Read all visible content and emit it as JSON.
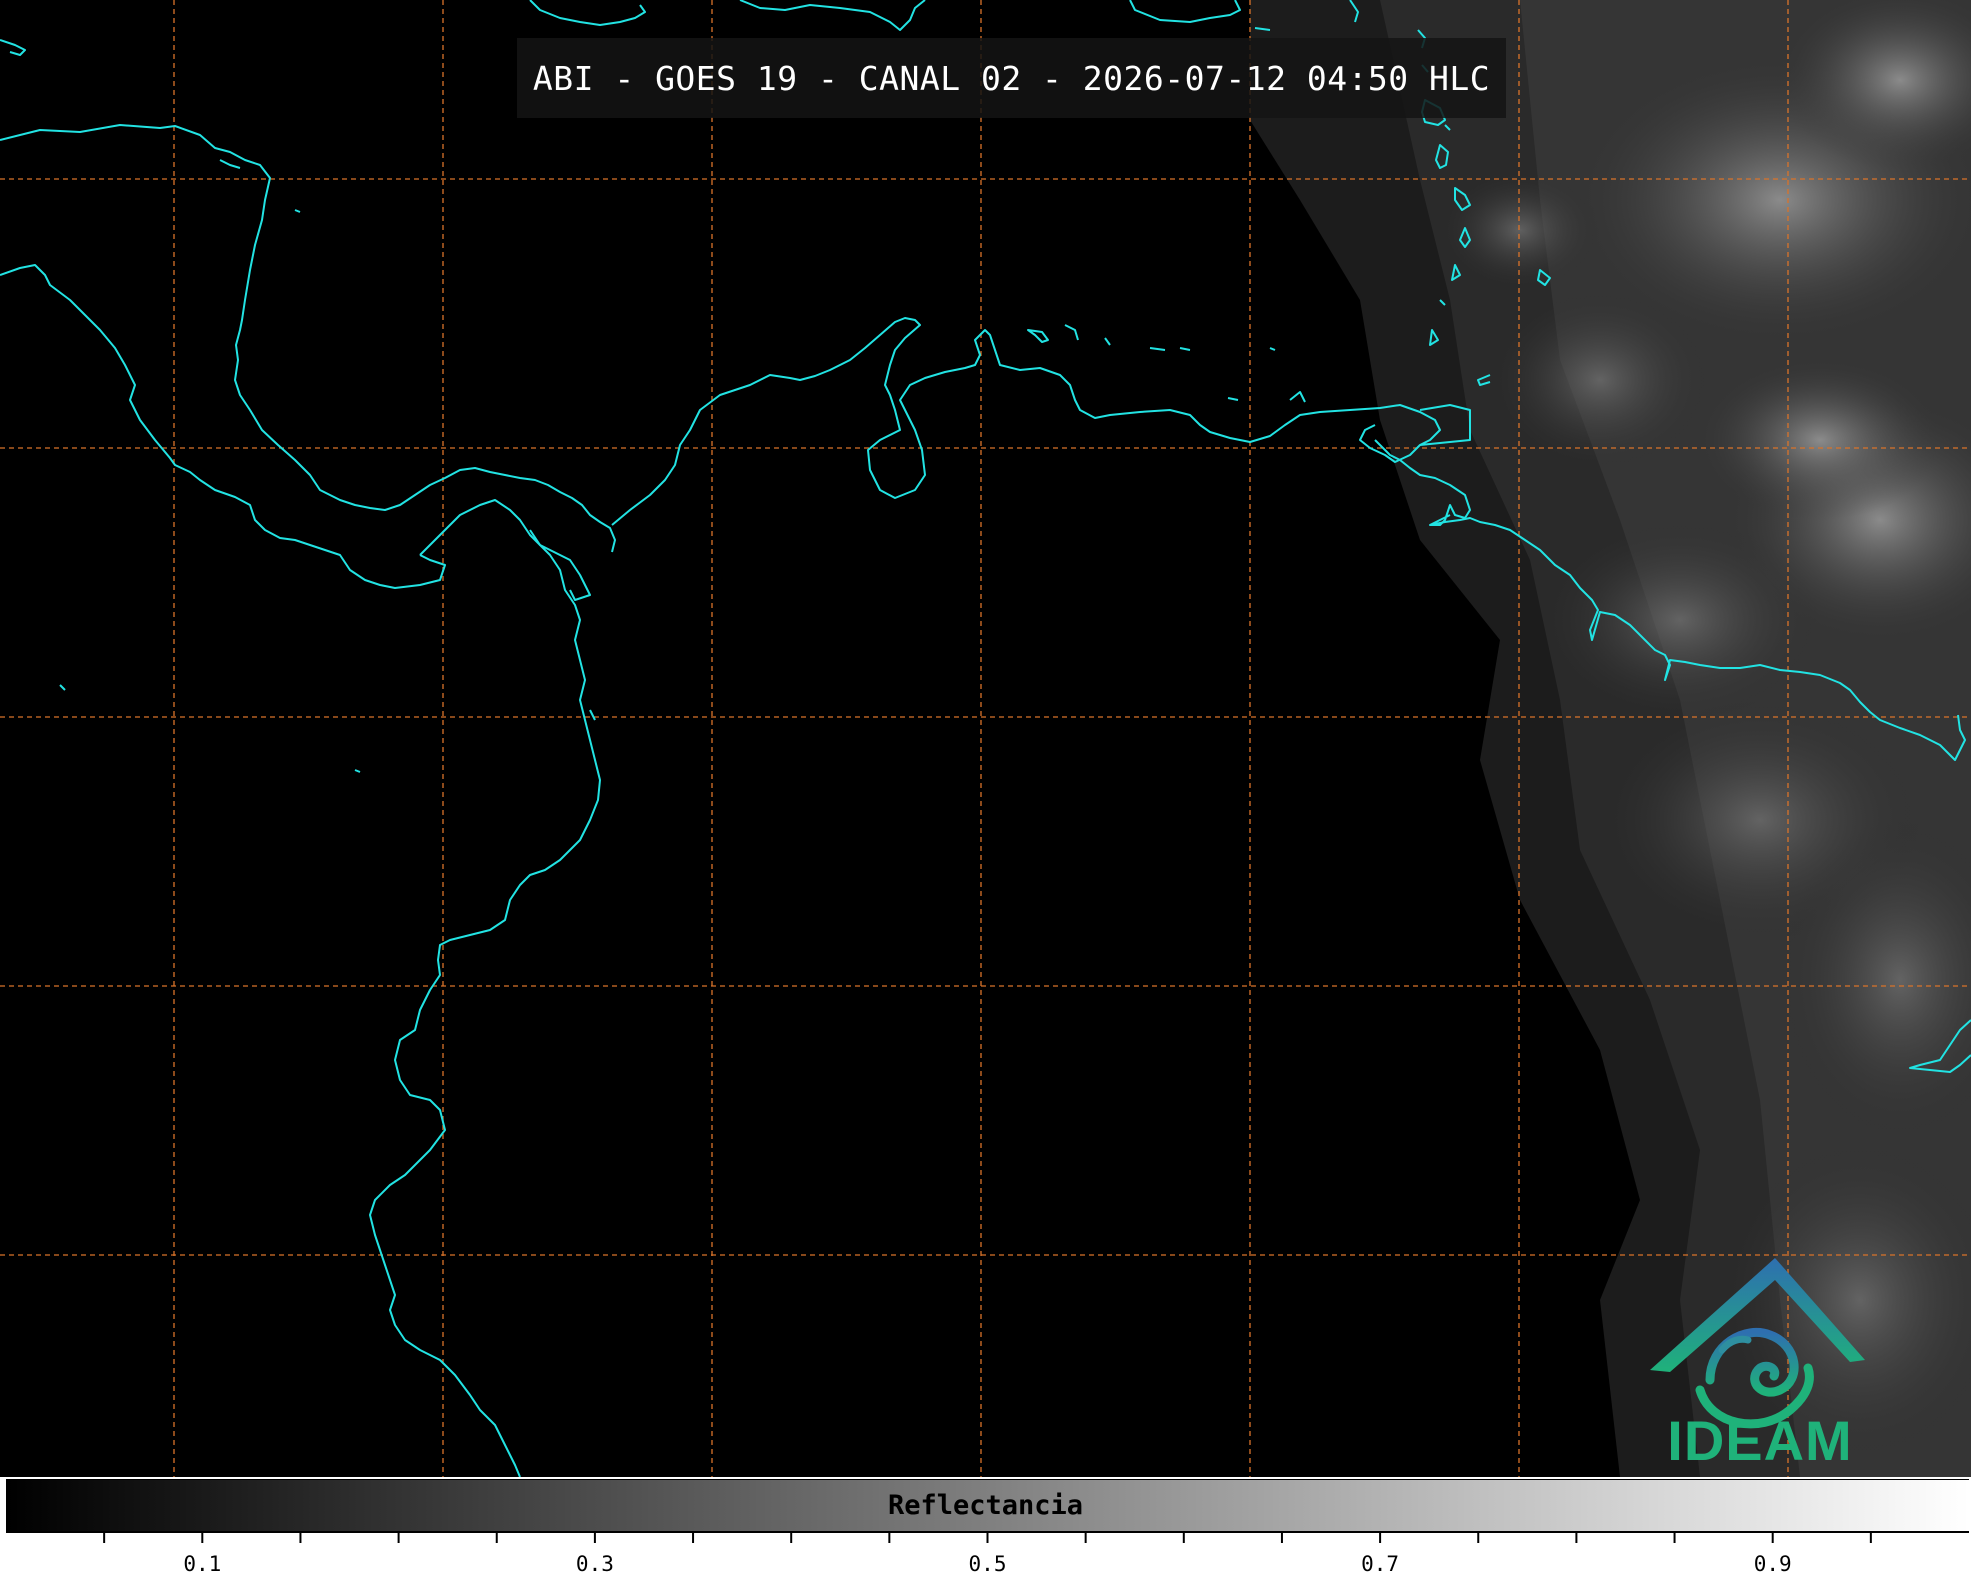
{
  "title": "ABI - GOES 19 - CANAL 02 - 2026-07-12 04:50 HLC",
  "logo": {
    "text": "IDEAM",
    "icon": "ideam-swirl-logo-icon",
    "color_blue": "#2e6fb0",
    "color_green": "#1fb27a"
  },
  "colorbar": {
    "label": "Reflectancia",
    "range": [
      0,
      1
    ],
    "colormap": "grayscale",
    "ticks": [
      {
        "value": 0.1,
        "label": "0.1"
      },
      {
        "value": 0.3,
        "label": "0.3"
      },
      {
        "value": 0.5,
        "label": "0.5"
      },
      {
        "value": 0.7,
        "label": "0.7"
      },
      {
        "value": 0.9,
        "label": "0.9"
      }
    ]
  },
  "map": {
    "coastline_color": "#22e3e3",
    "grid_color": "#d9732a",
    "grid_style": "dashed",
    "background": "#000000"
  }
}
